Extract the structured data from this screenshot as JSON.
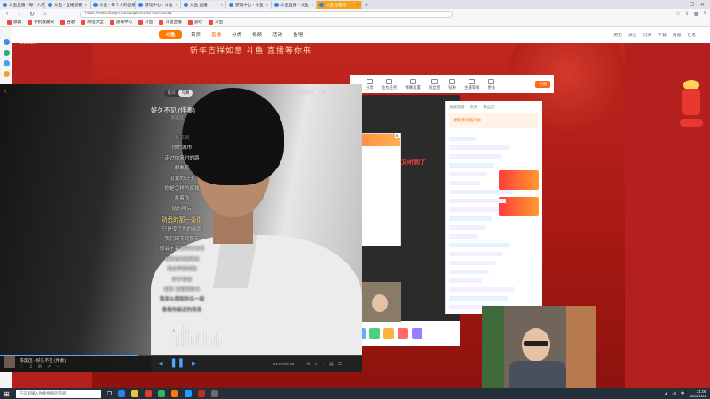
{
  "browser": {
    "tabs": [
      {
        "label": "斗鱼直播 - 每个人的直播平台"
      },
      {
        "label": "斗鱼 - 直播观看"
      },
      {
        "label": "斗鱼 - 每个人的直播"
      },
      {
        "label": "游戏中心 - 斗鱼"
      },
      {
        "label": "斗鱼 直播"
      },
      {
        "label": "游戏中心 - 斗鱼"
      },
      {
        "label": "斗鱼直播 - 斗鱼"
      },
      {
        "label": "斗鱼直播间",
        "active": true
      }
    ],
    "url": "https://www.douyu.com/topic/xmhd?rid=96291",
    "bookmarks": [
      "收藏",
      "手机收藏夹",
      "谷歌",
      "网址大全",
      "游戏中心",
      "斗鱼",
      "斗鱼直播",
      "游戏",
      "斗鱼"
    ]
  },
  "site": {
    "logo": "斗鱼",
    "nav": [
      "首页",
      "直播",
      "分类",
      "视频",
      "活动",
      "鱼吧"
    ],
    "active_nav": "直播",
    "header_right": [
      "历史",
      "关注",
      "订阅",
      "下载",
      "消息",
      "任务"
    ],
    "room_id": "96291",
    "banner_title": "新年吉祥如意 斗鱼 直播等你来",
    "live_tools": [
      "分享",
      "鱼丸任务",
      "弹幕设置",
      "粉丝团",
      "钻粉",
      "主播等级",
      "更多"
    ],
    "recharge": "充值",
    "overlay_text": "又听到了",
    "chat_tabs": [
      "贡献周榜",
      "贵宾",
      "粉丝团"
    ],
    "promo": "福利活动进行中"
  },
  "music": {
    "mode_options": [
      "歌词",
      "写真"
    ],
    "mode_active": "写真",
    "top_actions": [
      "桌面歌词",
      "写真",
      "⛶"
    ],
    "song_title": "好久不见 (伴奏)",
    "artist": "陈奕迅",
    "lyrics": [
      "我来到",
      "你的城市",
      "走过你来时的路",
      "想象着",
      "没我的日子",
      "你是怎样的孤独",
      "拿着你",
      "给的照片",
      "熟悉的那一条街",
      "只是没了你的画面",
      "我们回不到那天",
      "你会不会忽然的出现",
      "在街角的咖啡店",
      "我会带着笑脸",
      "挥手寒暄",
      "和你 坐着聊聊天",
      "我多么想和你见一面",
      "看看你最近的改变"
    ],
    "current_lyric_index": 8,
    "mini_title": "陈奕迅 - 好久不见 (伴奏)",
    "time": "01:27/03:48",
    "progress": 0.38
  },
  "taskbar": {
    "search_placeholder": "在这里输入你要搜索的内容",
    "time": "21:05",
    "date": "2021/1/21",
    "lang": "中"
  },
  "colors": {
    "accent": "#ff6a1a",
    "player_blue": "#4ea8ff",
    "banner_red": "#b3201d",
    "lyric_highlight": "#ffe27a"
  }
}
